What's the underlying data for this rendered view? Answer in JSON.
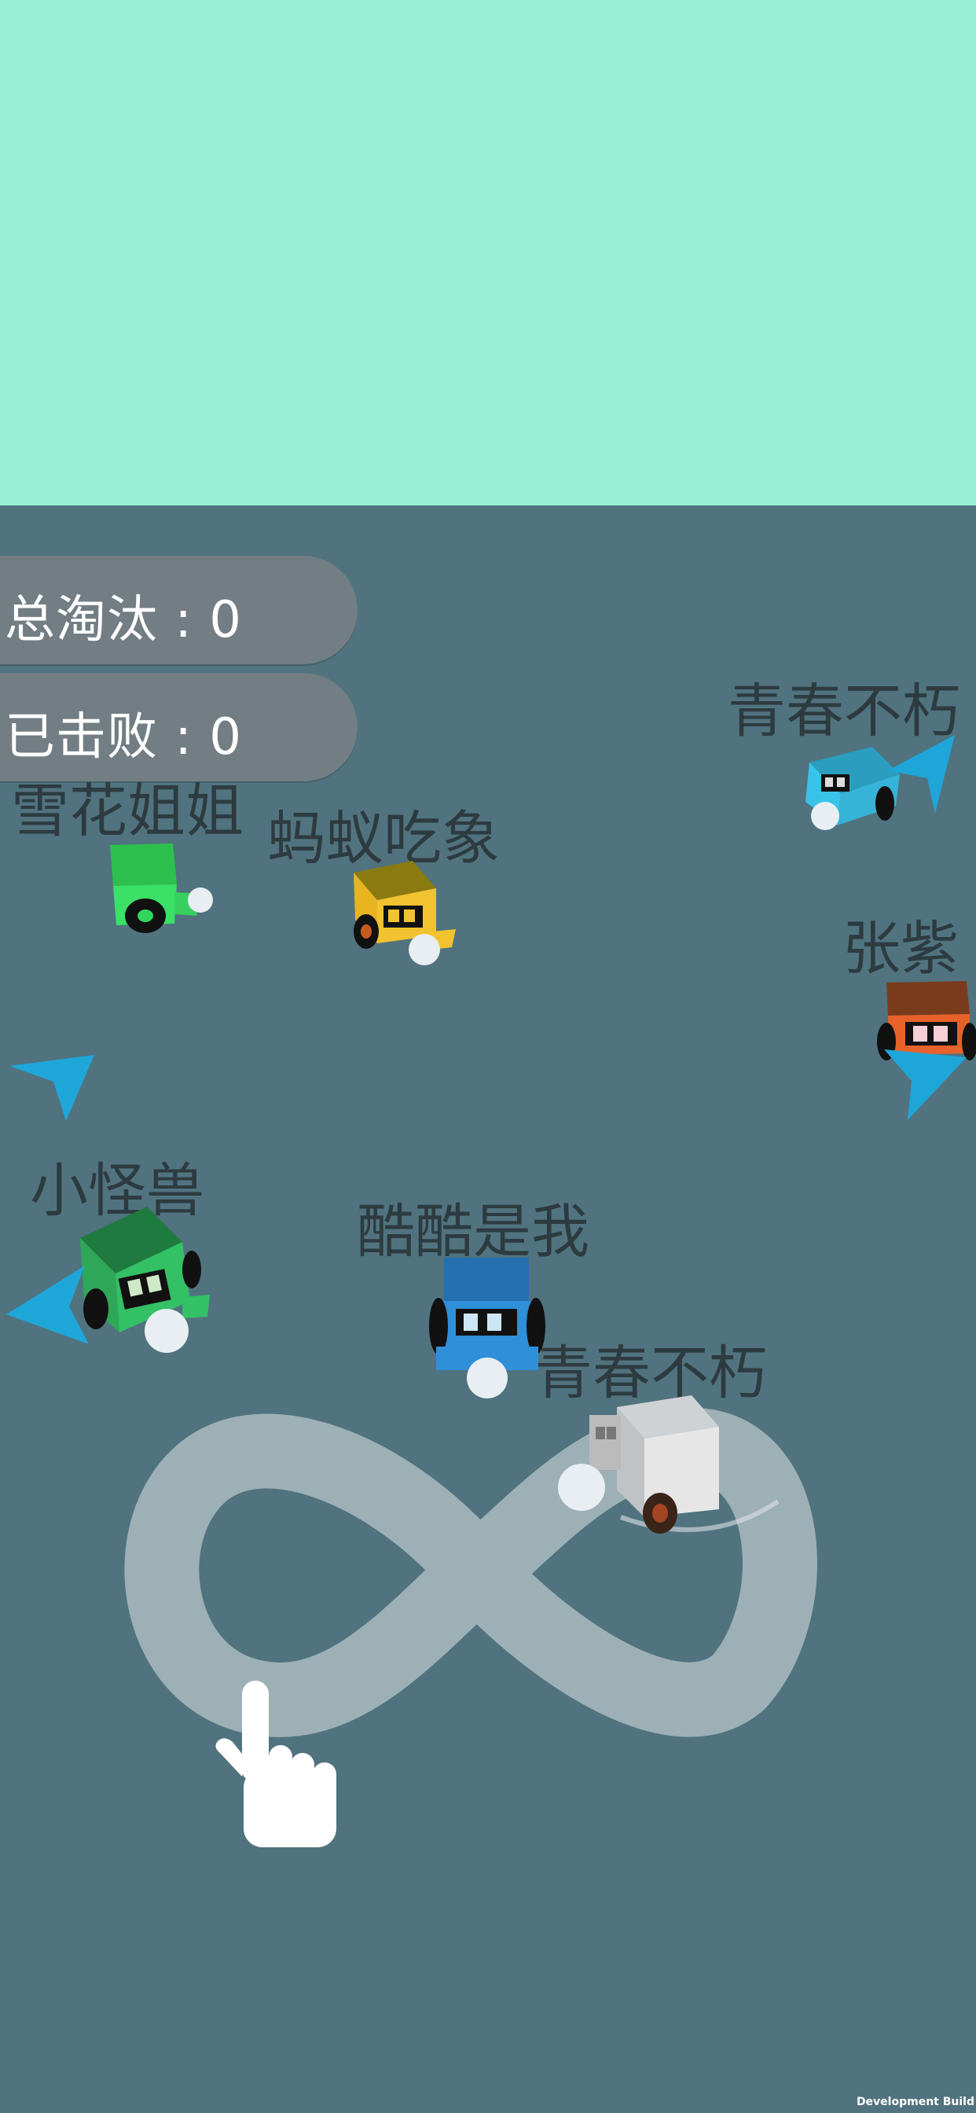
{
  "hud": {
    "eliminated_total": "总淘汰 : 0",
    "defeated": "已击败 : 0"
  },
  "players": [
    {
      "name": "青春不朽",
      "color": "#39c3e8"
    },
    {
      "name": "雪花姐姐",
      "color": "#2fd65a"
    },
    {
      "name": "蚂蚁吃象",
      "color": "#f2c230"
    },
    {
      "name": "张紫",
      "color": "#e7622a"
    },
    {
      "name": "小怪兽",
      "color": "#2ea858"
    },
    {
      "name": "酷酷是我",
      "color": "#2f8fd8"
    },
    {
      "name": "青春不朽",
      "color": "#e6e6e6"
    }
  ],
  "hint": {
    "icon": "hand-pointer-icon",
    "path_icon": "infinity-path-icon"
  },
  "footer": {
    "build_label": "Development Build"
  },
  "colors": {
    "sky": "#98f0d5",
    "arena": "#50737f",
    "pointer_arrow": "#1fa6d9"
  }
}
